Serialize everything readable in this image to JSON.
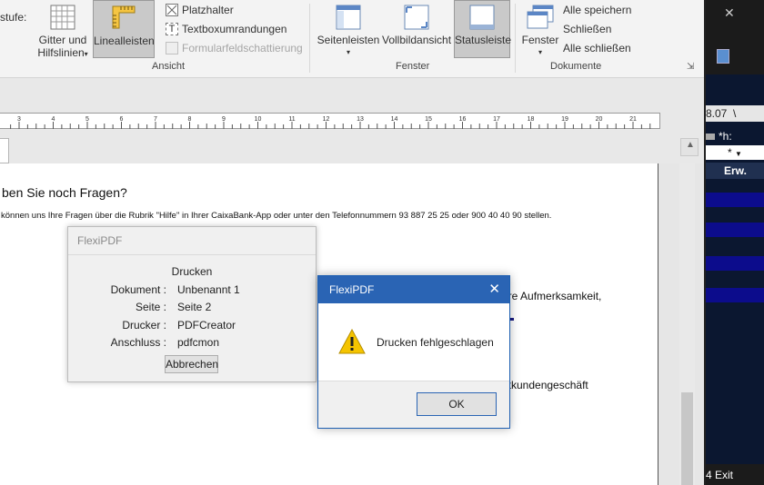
{
  "ribbon": {
    "stufe_label": "stufe:",
    "gitter_label_1": "Gitter und",
    "gitter_label_2": "Hilfslinien",
    "linealleisten_label": "Linealleisten",
    "platzhalter_label": "Platzhalter",
    "textboxumrandungen_label": "Textboxumrandungen",
    "formularfeld_label": "Formularfeldschattierung",
    "ansicht_group": "Ansicht",
    "seitenleisten_label": "Seitenleisten",
    "vollbild_label": "Vollbildansicht",
    "statusleiste_label": "Statusleiste",
    "fenster_group": "Fenster",
    "fenster_label": "Fenster",
    "alle_speichern": "Alle speichern",
    "schliessen": "Schließen",
    "alle_schliessen": "Alle schließen",
    "dokumente_group": "Dokumente"
  },
  "ruler": {
    "ticks": [
      "3",
      "4",
      "5",
      "6",
      "7",
      "8",
      "9",
      "10",
      "11",
      "12",
      "13",
      "14",
      "15",
      "16",
      "17",
      "18",
      "19",
      "20",
      "21"
    ]
  },
  "document": {
    "heading": "ben Sie noch Fragen?",
    "line1": "können uns Ihre Fragen über die Rubrik \"Hilfe\" in Ihrer CaixaBank-App oder unter den Telefonnummern 93 887 25 25 oder 900 40 40 90 stellen.",
    "frag1": "hre Aufmerksamkeit,",
    "frag2": "atkundengeschäft"
  },
  "right_app": {
    "date": "8.07",
    "sep": "\\",
    "h_label": "*h:",
    "star": "*",
    "col_header": "Erw.",
    "exit": "4 Exit"
  },
  "print_dialog": {
    "title": "FlexiPDF",
    "heading": "Drucken",
    "rows": [
      {
        "label": "Dokument :",
        "value": "Unbenannt 1"
      },
      {
        "label": "Seite :",
        "value": "Seite 2"
      },
      {
        "label": "Drucker :",
        "value": "PDFCreator"
      },
      {
        "label": "Anschluss :",
        "value": "pdfcmon"
      }
    ],
    "cancel_label": "Abbrechen"
  },
  "error_dialog": {
    "title": "FlexiPDF",
    "close_glyph": "✕",
    "message": "Drucken fehlgeschlagen",
    "ok_label": "OK"
  },
  "colors": {
    "dialog_blue": "#2a64b4",
    "right_app_bg": "#0b1730",
    "right_app_band": "#0c0c8c"
  }
}
